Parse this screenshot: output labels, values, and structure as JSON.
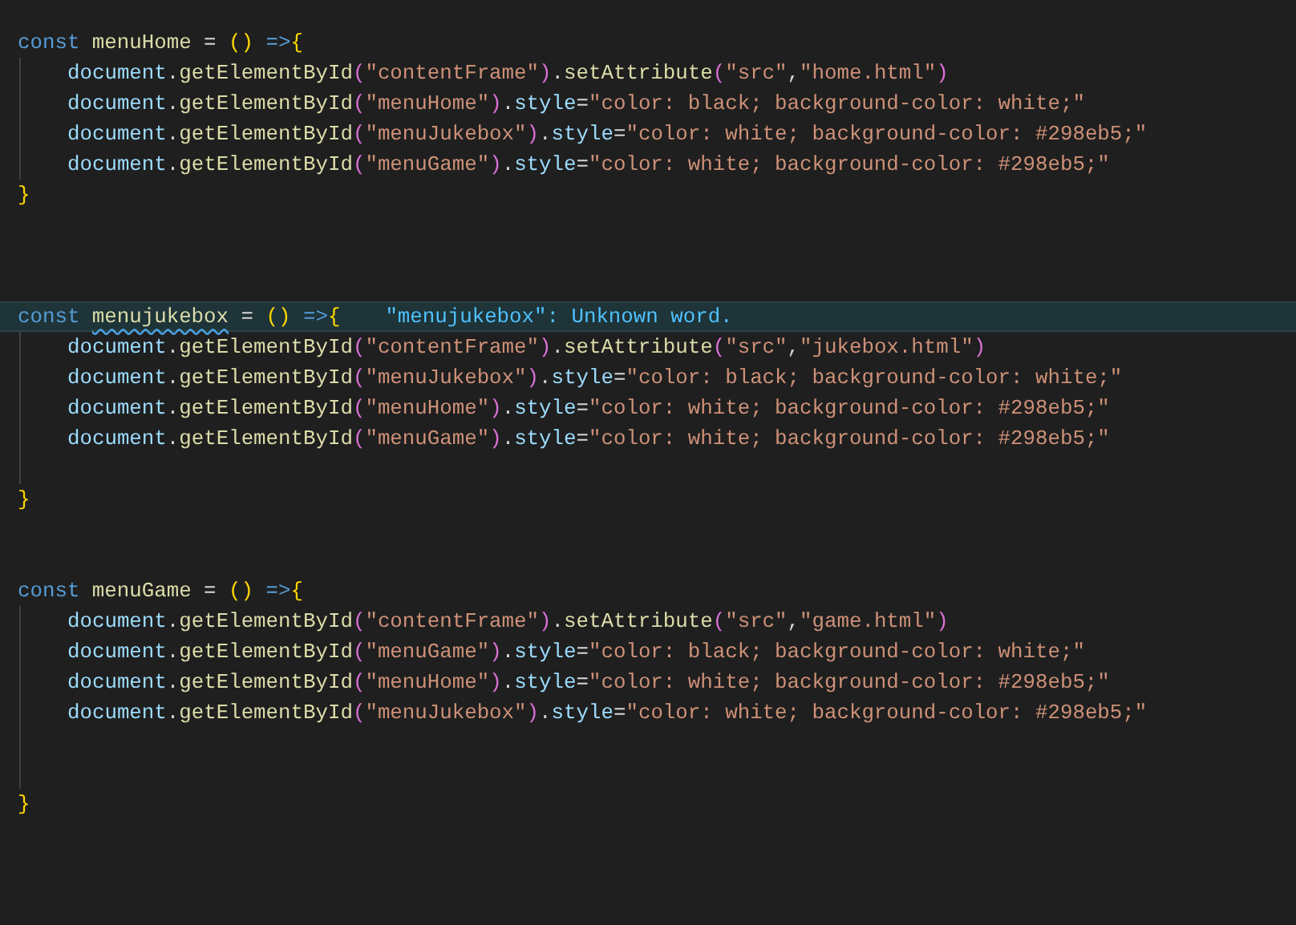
{
  "editor": {
    "lines": [
      {
        "indented": false,
        "highlighted": false,
        "tokens": [
          {
            "text": "const ",
            "kind": "kw"
          },
          {
            "text": "menuHome",
            "kind": "fn"
          },
          {
            "text": " = ",
            "kind": "op"
          },
          {
            "text": "()",
            "kind": "br1"
          },
          {
            "text": " =>",
            "kind": "kw"
          },
          {
            "text": "{",
            "kind": "br1"
          }
        ]
      },
      {
        "indented": true,
        "highlighted": false,
        "tokens": [
          {
            "text": "document",
            "kind": "var"
          },
          {
            "text": ".",
            "kind": "op"
          },
          {
            "text": "getElementById",
            "kind": "fn"
          },
          {
            "text": "(",
            "kind": "br2"
          },
          {
            "text": "\"contentFrame\"",
            "kind": "str"
          },
          {
            "text": ")",
            "kind": "br2"
          },
          {
            "text": ".",
            "kind": "op"
          },
          {
            "text": "setAttribute",
            "kind": "fn"
          },
          {
            "text": "(",
            "kind": "br2"
          },
          {
            "text": "\"src\"",
            "kind": "str"
          },
          {
            "text": ",",
            "kind": "op"
          },
          {
            "text": "\"home.html\"",
            "kind": "str"
          },
          {
            "text": ")",
            "kind": "br2"
          }
        ]
      },
      {
        "indented": true,
        "highlighted": false,
        "tokens": [
          {
            "text": "document",
            "kind": "var"
          },
          {
            "text": ".",
            "kind": "op"
          },
          {
            "text": "getElementById",
            "kind": "fn"
          },
          {
            "text": "(",
            "kind": "br2"
          },
          {
            "text": "\"menuHome\"",
            "kind": "str"
          },
          {
            "text": ")",
            "kind": "br2"
          },
          {
            "text": ".",
            "kind": "op"
          },
          {
            "text": "style",
            "kind": "var"
          },
          {
            "text": "=",
            "kind": "op"
          },
          {
            "text": "\"color: black; background-color: white;\"",
            "kind": "str"
          }
        ]
      },
      {
        "indented": true,
        "highlighted": false,
        "tokens": [
          {
            "text": "document",
            "kind": "var"
          },
          {
            "text": ".",
            "kind": "op"
          },
          {
            "text": "getElementById",
            "kind": "fn"
          },
          {
            "text": "(",
            "kind": "br2"
          },
          {
            "text": "\"menuJukebox\"",
            "kind": "str"
          },
          {
            "text": ")",
            "kind": "br2"
          },
          {
            "text": ".",
            "kind": "op"
          },
          {
            "text": "style",
            "kind": "var"
          },
          {
            "text": "=",
            "kind": "op"
          },
          {
            "text": "\"color: white; background-color: #298eb5;\"",
            "kind": "str"
          }
        ]
      },
      {
        "indented": true,
        "highlighted": false,
        "tokens": [
          {
            "text": "document",
            "kind": "var"
          },
          {
            "text": ".",
            "kind": "op"
          },
          {
            "text": "getElementById",
            "kind": "fn"
          },
          {
            "text": "(",
            "kind": "br2"
          },
          {
            "text": "\"menuGame\"",
            "kind": "str"
          },
          {
            "text": ")",
            "kind": "br2"
          },
          {
            "text": ".",
            "kind": "op"
          },
          {
            "text": "style",
            "kind": "var"
          },
          {
            "text": "=",
            "kind": "op"
          },
          {
            "text": "\"color: white; background-color: #298eb5;\"",
            "kind": "str"
          }
        ]
      },
      {
        "indented": false,
        "highlighted": false,
        "tokens": [
          {
            "text": "}",
            "kind": "br1"
          }
        ]
      },
      {
        "indented": false,
        "highlighted": false
      },
      {
        "indented": false,
        "highlighted": false
      },
      {
        "indented": false,
        "highlighted": false
      },
      {
        "indented": false,
        "highlighted": true,
        "hint": "\"menujukebox\": Unknown word.",
        "tokens": [
          {
            "text": "const ",
            "kind": "kw"
          },
          {
            "text": "menujukebox",
            "kind": "fn",
            "squiggle": true
          },
          {
            "text": " = ",
            "kind": "op"
          },
          {
            "text": "()",
            "kind": "br1"
          },
          {
            "text": " =>",
            "kind": "kw"
          },
          {
            "text": "{",
            "kind": "br1"
          }
        ]
      },
      {
        "indented": true,
        "highlighted": false,
        "tokens": [
          {
            "text": "document",
            "kind": "var"
          },
          {
            "text": ".",
            "kind": "op"
          },
          {
            "text": "getElementById",
            "kind": "fn"
          },
          {
            "text": "(",
            "kind": "br2"
          },
          {
            "text": "\"contentFrame\"",
            "kind": "str"
          },
          {
            "text": ")",
            "kind": "br2"
          },
          {
            "text": ".",
            "kind": "op"
          },
          {
            "text": "setAttribute",
            "kind": "fn"
          },
          {
            "text": "(",
            "kind": "br2"
          },
          {
            "text": "\"src\"",
            "kind": "str"
          },
          {
            "text": ",",
            "kind": "op"
          },
          {
            "text": "\"jukebox.html\"",
            "kind": "str"
          },
          {
            "text": ")",
            "kind": "br2"
          }
        ]
      },
      {
        "indented": true,
        "highlighted": false,
        "tokens": [
          {
            "text": "document",
            "kind": "var"
          },
          {
            "text": ".",
            "kind": "op"
          },
          {
            "text": "getElementById",
            "kind": "fn"
          },
          {
            "text": "(",
            "kind": "br2"
          },
          {
            "text": "\"menuJukebox\"",
            "kind": "str"
          },
          {
            "text": ")",
            "kind": "br2"
          },
          {
            "text": ".",
            "kind": "op"
          },
          {
            "text": "style",
            "kind": "var"
          },
          {
            "text": "=",
            "kind": "op"
          },
          {
            "text": "\"color: black; background-color: white;\"",
            "kind": "str"
          }
        ]
      },
      {
        "indented": true,
        "highlighted": false,
        "tokens": [
          {
            "text": "document",
            "kind": "var"
          },
          {
            "text": ".",
            "kind": "op"
          },
          {
            "text": "getElementById",
            "kind": "fn"
          },
          {
            "text": "(",
            "kind": "br2"
          },
          {
            "text": "\"menuHome\"",
            "kind": "str"
          },
          {
            "text": ")",
            "kind": "br2"
          },
          {
            "text": ".",
            "kind": "op"
          },
          {
            "text": "style",
            "kind": "var"
          },
          {
            "text": "=",
            "kind": "op"
          },
          {
            "text": "\"color: white; background-color: #298eb5;\"",
            "kind": "str"
          }
        ]
      },
      {
        "indented": true,
        "highlighted": false,
        "tokens": [
          {
            "text": "document",
            "kind": "var"
          },
          {
            "text": ".",
            "kind": "op"
          },
          {
            "text": "getElementById",
            "kind": "fn"
          },
          {
            "text": "(",
            "kind": "br2"
          },
          {
            "text": "\"menuGame\"",
            "kind": "str"
          },
          {
            "text": ")",
            "kind": "br2"
          },
          {
            "text": ".",
            "kind": "op"
          },
          {
            "text": "style",
            "kind": "var"
          },
          {
            "text": "=",
            "kind": "op"
          },
          {
            "text": "\"color: white; background-color: #298eb5;\"",
            "kind": "str"
          }
        ]
      },
      {
        "indented": true,
        "highlighted": false
      },
      {
        "indented": false,
        "highlighted": false,
        "tokens": [
          {
            "text": "}",
            "kind": "br1"
          }
        ]
      },
      {
        "indented": false,
        "highlighted": false
      },
      {
        "indented": false,
        "highlighted": false
      },
      {
        "indented": false,
        "highlighted": false,
        "tokens": [
          {
            "text": "const ",
            "kind": "kw"
          },
          {
            "text": "menuGame",
            "kind": "fn"
          },
          {
            "text": " = ",
            "kind": "op"
          },
          {
            "text": "()",
            "kind": "br1"
          },
          {
            "text": " =>",
            "kind": "kw"
          },
          {
            "text": "{",
            "kind": "br1"
          }
        ]
      },
      {
        "indented": true,
        "highlighted": false,
        "tokens": [
          {
            "text": "document",
            "kind": "var"
          },
          {
            "text": ".",
            "kind": "op"
          },
          {
            "text": "getElementById",
            "kind": "fn"
          },
          {
            "text": "(",
            "kind": "br2"
          },
          {
            "text": "\"contentFrame\"",
            "kind": "str"
          },
          {
            "text": ")",
            "kind": "br2"
          },
          {
            "text": ".",
            "kind": "op"
          },
          {
            "text": "setAttribute",
            "kind": "fn"
          },
          {
            "text": "(",
            "kind": "br2"
          },
          {
            "text": "\"src\"",
            "kind": "str"
          },
          {
            "text": ",",
            "kind": "op"
          },
          {
            "text": "\"game.html\"",
            "kind": "str"
          },
          {
            "text": ")",
            "kind": "br2"
          }
        ]
      },
      {
        "indented": true,
        "highlighted": false,
        "tokens": [
          {
            "text": "document",
            "kind": "var"
          },
          {
            "text": ".",
            "kind": "op"
          },
          {
            "text": "getElementById",
            "kind": "fn"
          },
          {
            "text": "(",
            "kind": "br2"
          },
          {
            "text": "\"menuGame\"",
            "kind": "str"
          },
          {
            "text": ")",
            "kind": "br2"
          },
          {
            "text": ".",
            "kind": "op"
          },
          {
            "text": "style",
            "kind": "var"
          },
          {
            "text": "=",
            "kind": "op"
          },
          {
            "text": "\"color: black; background-color: white;\"",
            "kind": "str"
          }
        ]
      },
      {
        "indented": true,
        "highlighted": false,
        "tokens": [
          {
            "text": "document",
            "kind": "var"
          },
          {
            "text": ".",
            "kind": "op"
          },
          {
            "text": "getElementById",
            "kind": "fn"
          },
          {
            "text": "(",
            "kind": "br2"
          },
          {
            "text": "\"menuHome\"",
            "kind": "str"
          },
          {
            "text": ")",
            "kind": "br2"
          },
          {
            "text": ".",
            "kind": "op"
          },
          {
            "text": "style",
            "kind": "var"
          },
          {
            "text": "=",
            "kind": "op"
          },
          {
            "text": "\"color: white; background-color: #298eb5;\"",
            "kind": "str"
          }
        ]
      },
      {
        "indented": true,
        "highlighted": false,
        "tokens": [
          {
            "text": "document",
            "kind": "var"
          },
          {
            "text": ".",
            "kind": "op"
          },
          {
            "text": "getElementById",
            "kind": "fn"
          },
          {
            "text": "(",
            "kind": "br2"
          },
          {
            "text": "\"menuJukebox\"",
            "kind": "str"
          },
          {
            "text": ")",
            "kind": "br2"
          },
          {
            "text": ".",
            "kind": "op"
          },
          {
            "text": "style",
            "kind": "var"
          },
          {
            "text": "=",
            "kind": "op"
          },
          {
            "text": "\"color: white; background-color: #298eb5;\"",
            "kind": "str"
          }
        ]
      },
      {
        "indented": true,
        "highlighted": false
      },
      {
        "indented": true,
        "highlighted": false
      },
      {
        "indented": false,
        "highlighted": false,
        "tokens": [
          {
            "text": "}",
            "kind": "br1"
          }
        ]
      }
    ]
  }
}
